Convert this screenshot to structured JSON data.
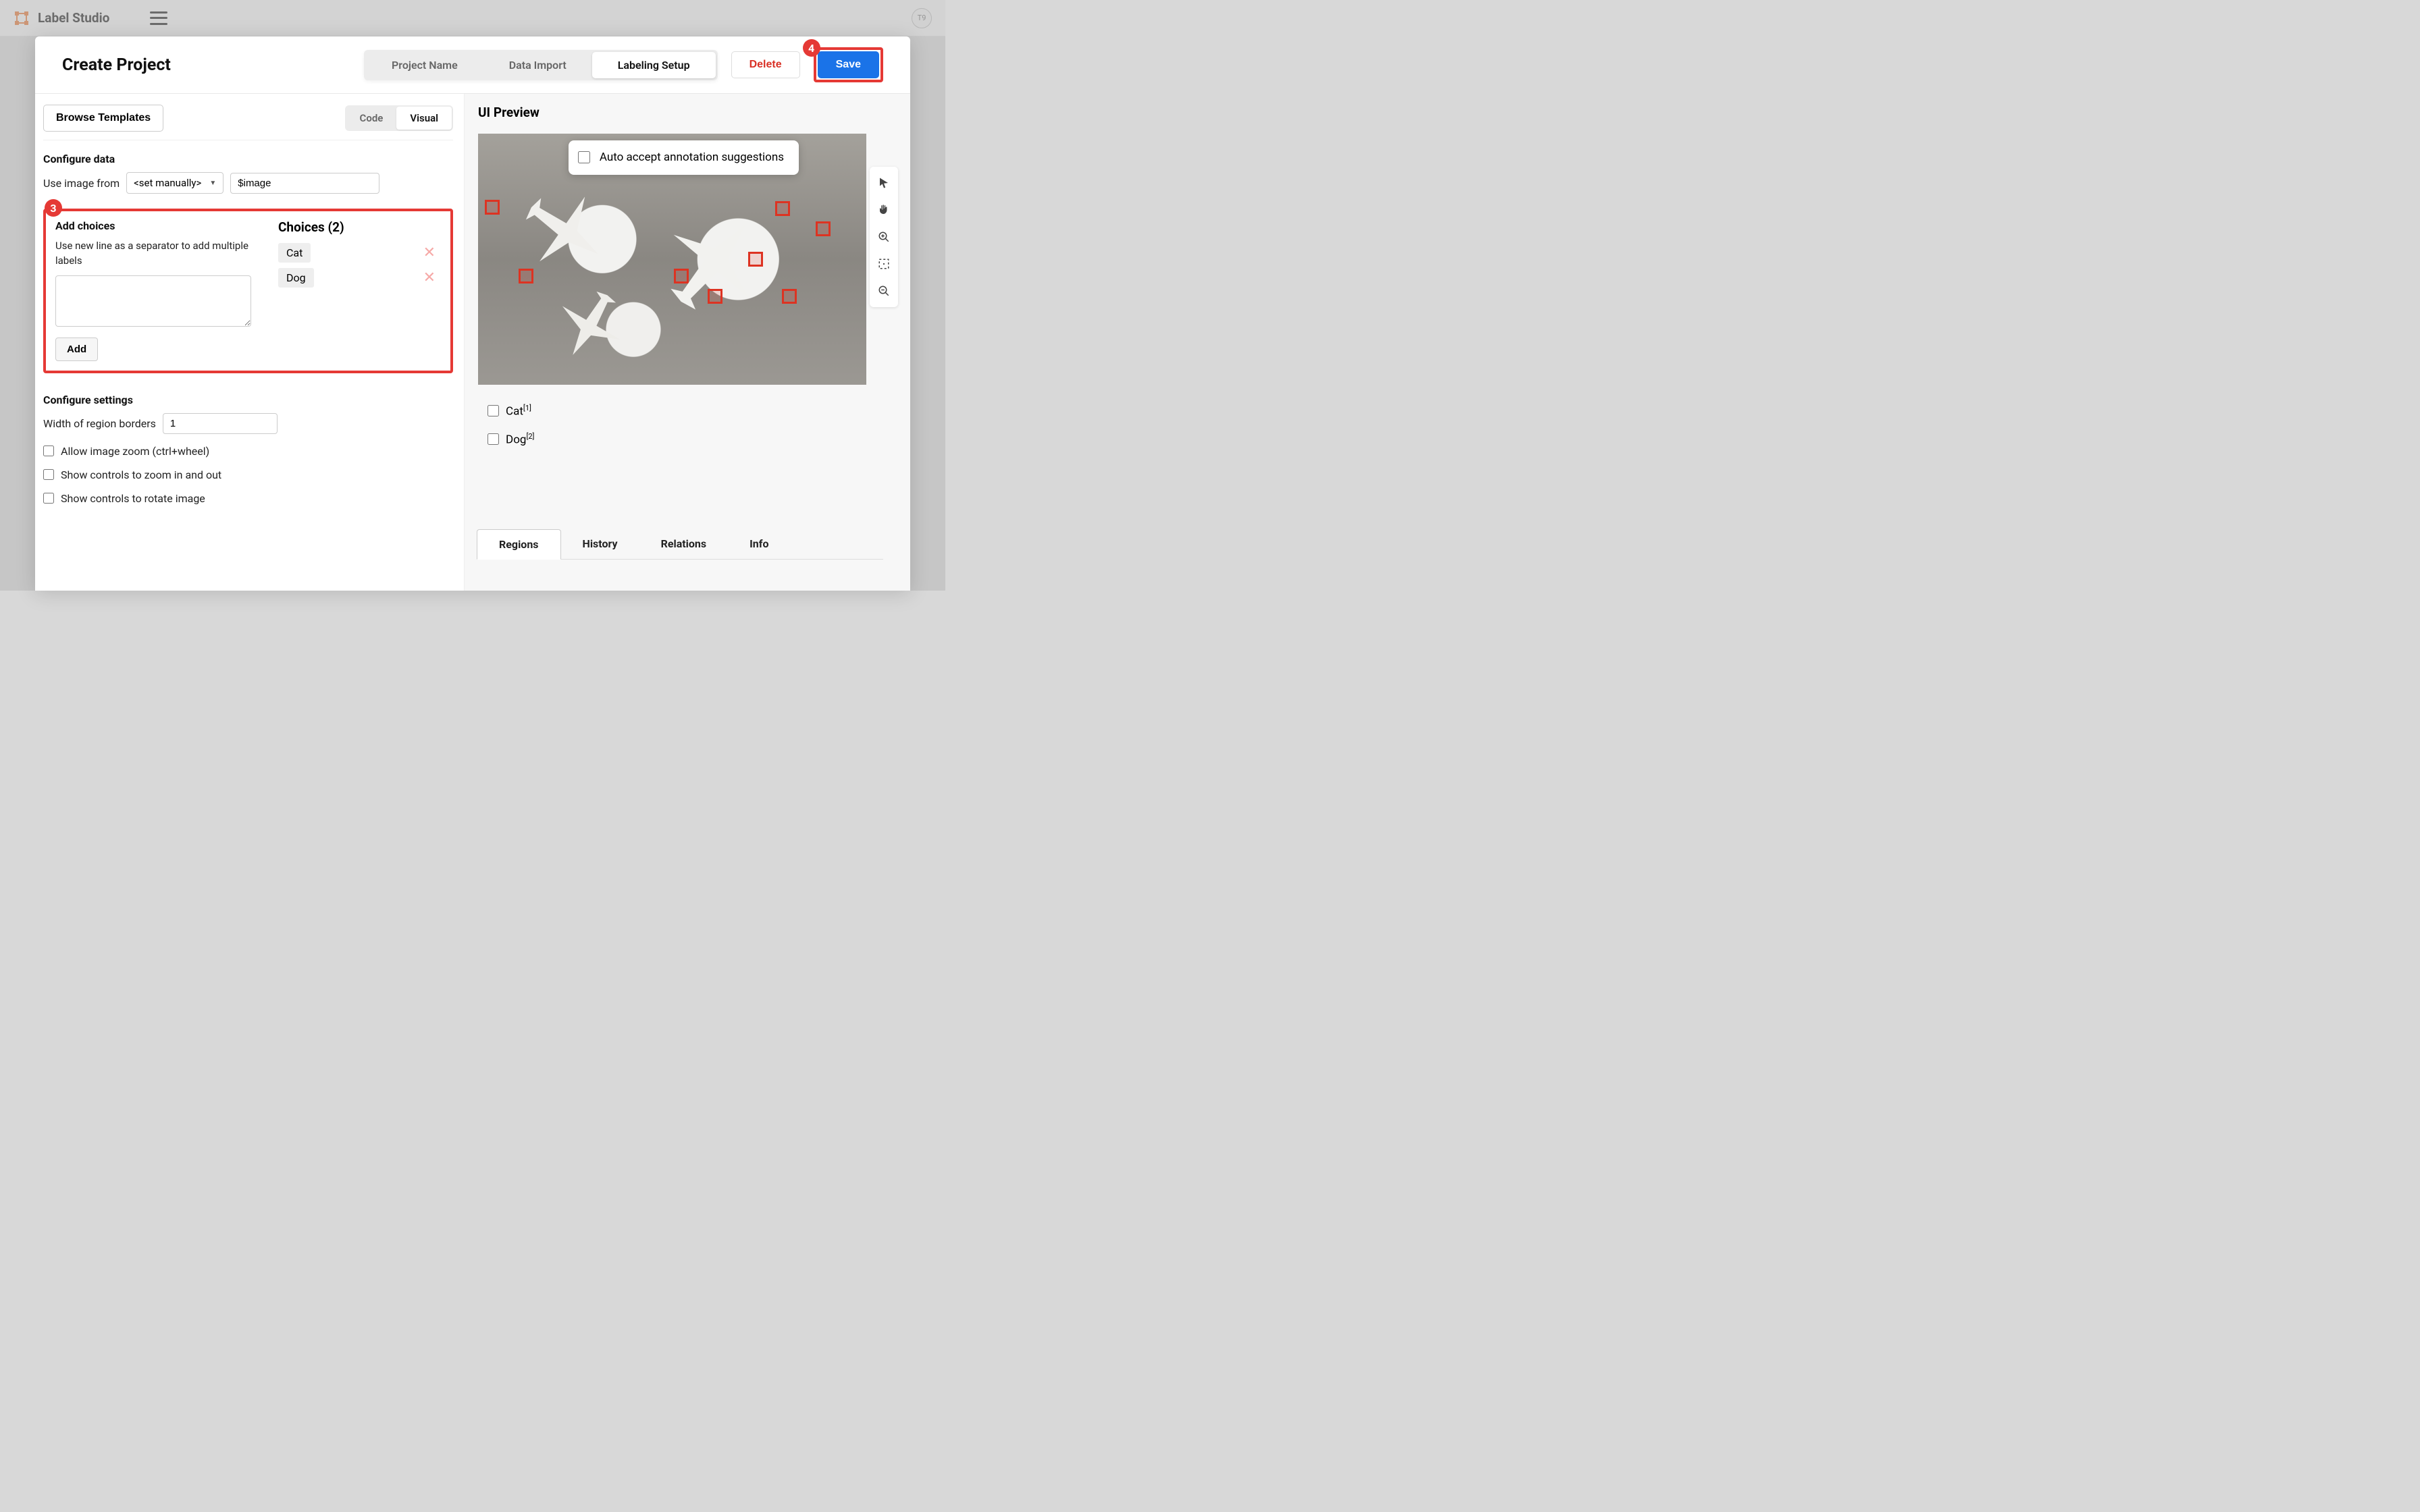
{
  "topbar": {
    "brand": "Label Studio",
    "avatar": "T9"
  },
  "modal": {
    "title": "Create Project",
    "tabs": {
      "project_name": "Project Name",
      "data_import": "Data Import",
      "labeling_setup": "Labeling Setup"
    },
    "buttons": {
      "delete": "Delete",
      "save": "Save"
    }
  },
  "leftpane": {
    "browse": "Browse Templates",
    "toggle": {
      "code": "Code",
      "visual": "Visual"
    },
    "configure_data": "Configure data",
    "use_image_from": "Use image from",
    "select_value": "<set manually>",
    "image_var": "$image",
    "add_choices": {
      "title": "Add choices",
      "hint": "Use new line as a separator to add multiple labels",
      "add_btn": "Add"
    },
    "choices": {
      "title": "Choices (2)",
      "items": [
        "Cat",
        "Dog"
      ]
    },
    "settings": {
      "title": "Configure settings",
      "border_label": "Width of region borders",
      "border_value": "1",
      "zoom": "Allow image zoom (ctrl+wheel)",
      "controls_zoom": "Show controls to zoom in and out",
      "controls_rotate": "Show controls to rotate image"
    }
  },
  "rightpane": {
    "title": "UI Preview",
    "auto_accept": "Auto accept annotation suggestions",
    "choices": [
      {
        "label": "Cat",
        "sup": "[1]"
      },
      {
        "label": "Dog",
        "sup": "[2]"
      }
    ],
    "tabs": [
      "Regions",
      "History",
      "Relations",
      "Info"
    ]
  },
  "callouts": {
    "c3": "3",
    "c4": "4"
  }
}
